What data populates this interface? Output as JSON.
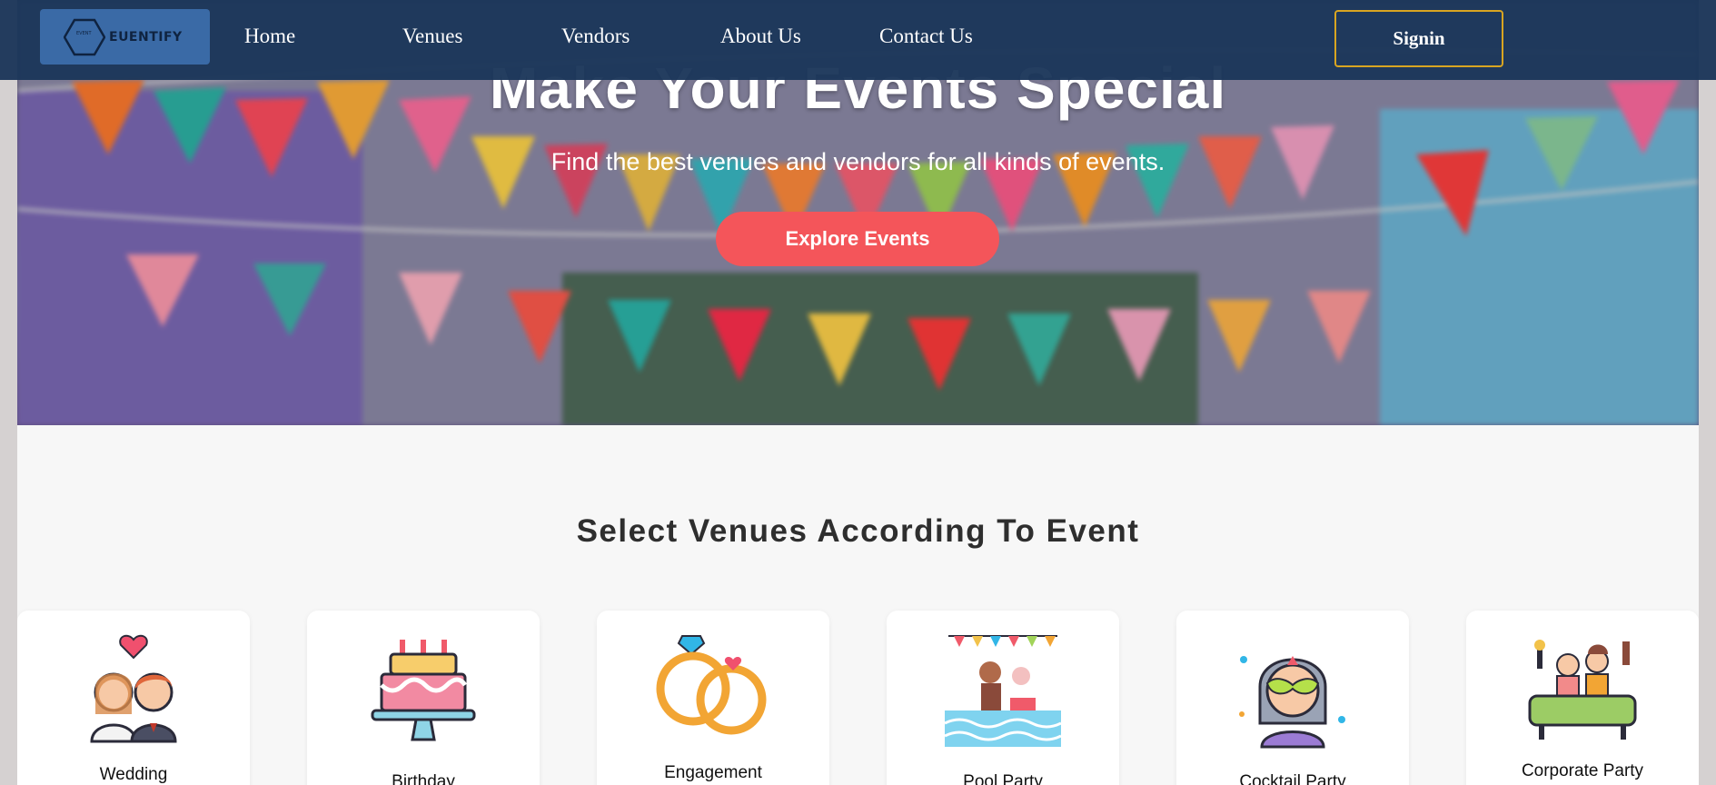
{
  "brand": {
    "name": "EUENTIFY"
  },
  "nav": {
    "links": [
      "Home",
      "Venues",
      "Vendors",
      "About Us",
      "Contact Us"
    ],
    "signin_label": "Signin"
  },
  "hero": {
    "title": "Make Your Events Special",
    "subtitle": "Find the best venues and vendors for all kinds of events.",
    "cta_label": "Explore Events"
  },
  "section": {
    "title": "Select Venues According To Event",
    "cards": [
      {
        "label": "Wedding",
        "icon": "wedding-couple-icon"
      },
      {
        "label": "Birthday",
        "icon": "birthday-cake-icon"
      },
      {
        "label": "Engagement",
        "icon": "engagement-rings-icon"
      },
      {
        "label": "Pool Party",
        "icon": "pool-party-icon"
      },
      {
        "label": "Cocktail Party",
        "icon": "masquerade-mask-icon"
      },
      {
        "label": "Corporate Party",
        "icon": "corporate-party-icon"
      }
    ]
  },
  "colors": {
    "nav_bg": "#1b365a",
    "accent_button": "#f4555a",
    "signin_border": "#d9a521",
    "logo_bg": "#3a6aa6"
  }
}
